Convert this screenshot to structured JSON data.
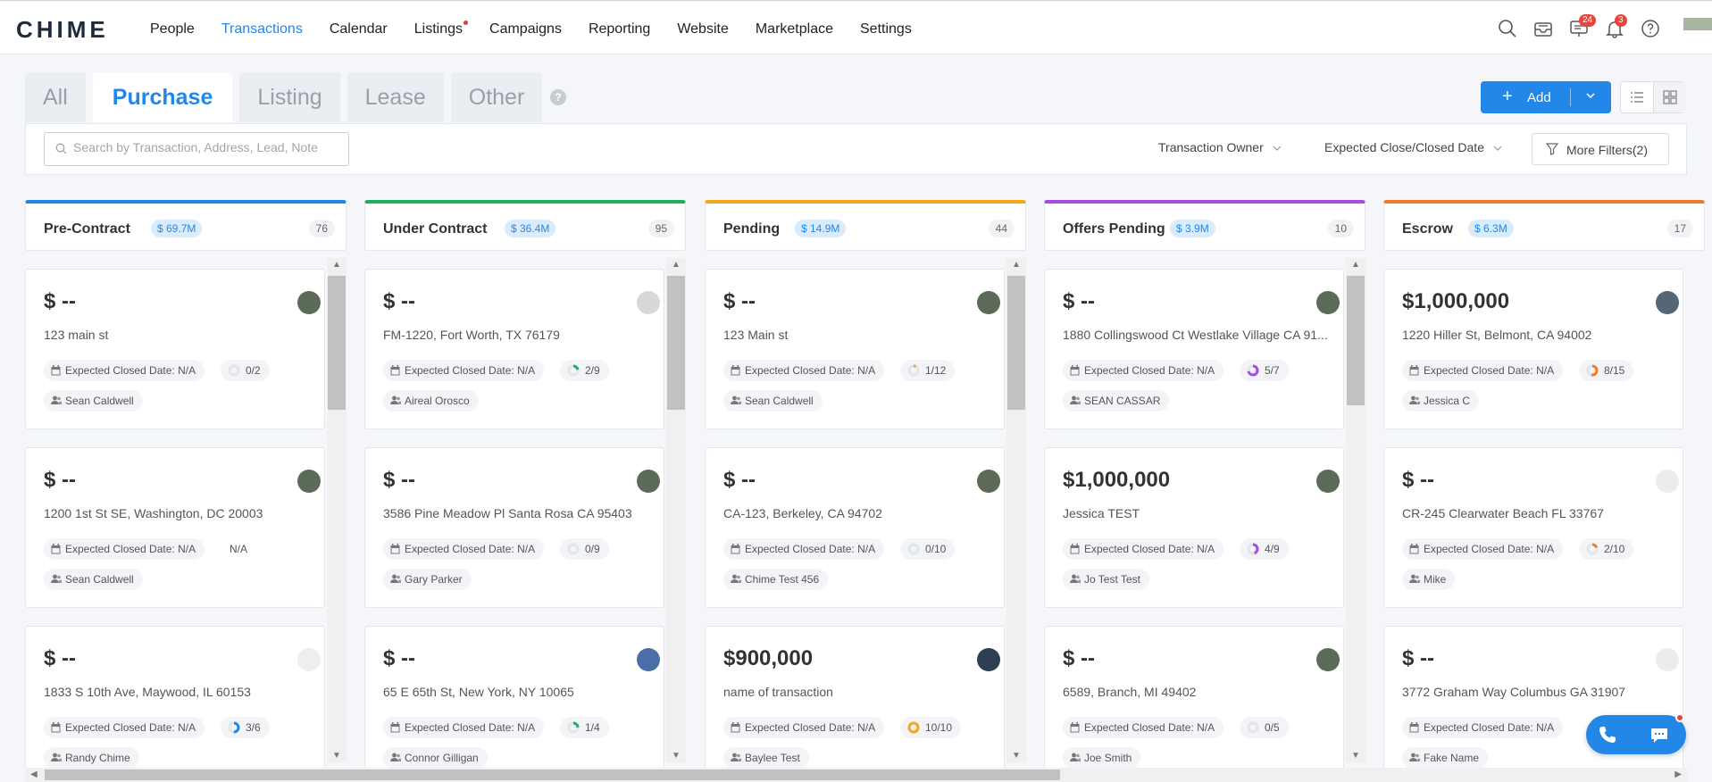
{
  "app": {
    "logo": "CHIME"
  },
  "nav": {
    "items": [
      {
        "label": "People"
      },
      {
        "label": "Transactions",
        "active": true
      },
      {
        "label": "Calendar"
      },
      {
        "label": "Listings",
        "dot": true
      },
      {
        "label": "Campaigns"
      },
      {
        "label": "Reporting"
      },
      {
        "label": "Website"
      },
      {
        "label": "Marketplace"
      },
      {
        "label": "Settings"
      }
    ],
    "badge_messages": "24",
    "badge_notifications": "3"
  },
  "tabs": [
    "All",
    "Purchase",
    "Listing",
    "Lease",
    "Other"
  ],
  "toolbar": {
    "add_label": "Add",
    "help": "?"
  },
  "filters": {
    "search_placeholder": "Search by Transaction, Address, Lead, Note",
    "owner": "Transaction Owner",
    "date": "Expected Close/Closed Date",
    "more": "More Filters(2)"
  },
  "colors": {
    "accent": "#2387e8",
    "precontract": "#2387e8",
    "under_contract": "#22b060",
    "pending": "#f2a818",
    "offers_pending": "#a64ce0",
    "escrow": "#ee7a2a"
  },
  "columns": [
    {
      "title": "Pre-Contract",
      "amount": "$ 69.7M",
      "count": "76",
      "cards": [
        {
          "price": "$ --",
          "address": "123 main st",
          "date": "Expected Closed Date: N/A",
          "progress": "0/2",
          "owner": "Sean Caldwell"
        },
        {
          "price": "$ --",
          "address": "1200 1st St SE, Washington, DC 20003",
          "date": "Expected Closed Date: N/A",
          "progress": "N/A",
          "owner": "Sean Caldwell"
        },
        {
          "price": "$ --",
          "address": "1833 S 10th Ave, Maywood, IL 60153",
          "date": "Expected Closed Date: N/A",
          "progress": "3/6",
          "owner": "Randy Chime"
        }
      ]
    },
    {
      "title": "Under Contract",
      "amount": "$ 36.4M",
      "count": "95",
      "cards": [
        {
          "price": "$ --",
          "address": "FM-1220, Fort Worth, TX 76179",
          "date": "Expected Closed Date: N/A",
          "progress": "2/9",
          "owner": "Aireal Orosco"
        },
        {
          "price": "$ --",
          "address": "3586 Pine Meadow Pl Santa Rosa CA 95403",
          "date": "Expected Closed Date: N/A",
          "progress": "0/9",
          "owner": "Gary Parker"
        },
        {
          "price": "$ --",
          "address": "65 E 65th St, New York, NY 10065",
          "date": "Expected Closed Date: N/A",
          "progress": "1/4",
          "owner": "Connor Gilligan"
        }
      ]
    },
    {
      "title": "Pending",
      "amount": "$ 14.9M",
      "count": "44",
      "cards": [
        {
          "price": "$ --",
          "address": "123 Main st",
          "date": "Expected Closed Date: N/A",
          "progress": "1/12",
          "owner": "Sean Caldwell"
        },
        {
          "price": "$ --",
          "address": "CA-123, Berkeley, CA 94702",
          "date": "Expected Closed Date: N/A",
          "progress": "0/10",
          "owner": "Chime Test 456"
        },
        {
          "price": "$900,000",
          "address": "name of transaction",
          "date": "Expected Closed Date: N/A",
          "progress": "10/10",
          "owner": "Baylee Test"
        }
      ]
    },
    {
      "title": "Offers Pending",
      "amount": "$ 3.9M",
      "count": "10",
      "cards": [
        {
          "price": "$ --",
          "address": "1880 Collingswood Ct Westlake Village CA 91...",
          "date": "Expected Closed Date: N/A",
          "progress": "5/7",
          "owner": "SEAN CASSAR"
        },
        {
          "price": "$1,000,000",
          "address": "Jessica TEST",
          "date": "Expected Closed Date: N/A",
          "progress": "4/9",
          "owner": "Jo Test Test"
        },
        {
          "price": "$ --",
          "address": "6589, Branch, MI 49402",
          "date": "Expected Closed Date: N/A",
          "progress": "0/5",
          "owner": "Joe Smith"
        }
      ]
    },
    {
      "title": "Escrow",
      "amount": "$ 6.3M",
      "count": "17",
      "cards": [
        {
          "price": "$1,000,000",
          "address": "1220 Hiller St, Belmont, CA 94002",
          "date": "Expected Closed Date: N/A",
          "progress": "8/15",
          "owner": "Jessica C"
        },
        {
          "price": "$ --",
          "address": "CR-245 Clearwater Beach FL 33767",
          "date": "Expected Closed Date: N/A",
          "progress": "2/10",
          "owner": "Mike"
        },
        {
          "price": "$ --",
          "address": "3772 Graham Way Columbus GA 31907",
          "date": "Expected Closed Date: N/A",
          "progress": "",
          "owner": "Fake Name"
        }
      ]
    }
  ]
}
